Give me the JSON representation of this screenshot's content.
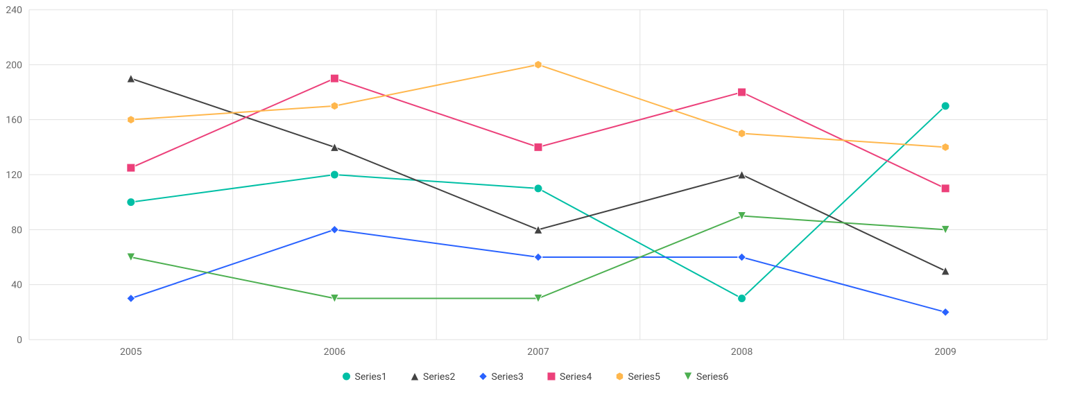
{
  "chart_data": {
    "type": "line",
    "categories": [
      "2005",
      "2006",
      "2007",
      "2008",
      "2009"
    ],
    "y_ticks": [
      0,
      40,
      80,
      120,
      160,
      200,
      240
    ],
    "ylim": [
      0,
      240
    ],
    "series": [
      {
        "name": "Series1",
        "color": "#00bfa5",
        "marker": "circle",
        "values": [
          100,
          120,
          110,
          30,
          170
        ]
      },
      {
        "name": "Series2",
        "color": "#424242",
        "marker": "triangle-up",
        "values": [
          190,
          140,
          80,
          120,
          50
        ]
      },
      {
        "name": "Series3",
        "color": "#2962ff",
        "marker": "diamond",
        "values": [
          30,
          80,
          60,
          60,
          20
        ]
      },
      {
        "name": "Series4",
        "color": "#ec407a",
        "marker": "square",
        "values": [
          125,
          190,
          140,
          180,
          110
        ]
      },
      {
        "name": "Series5",
        "color": "#ffb74d",
        "marker": "hexagon",
        "values": [
          160,
          170,
          200,
          150,
          140
        ]
      },
      {
        "name": "Series6",
        "color": "#4caf50",
        "marker": "triangle-down",
        "values": [
          60,
          30,
          30,
          90,
          80
        ]
      }
    ],
    "legend_position": "bottom"
  }
}
